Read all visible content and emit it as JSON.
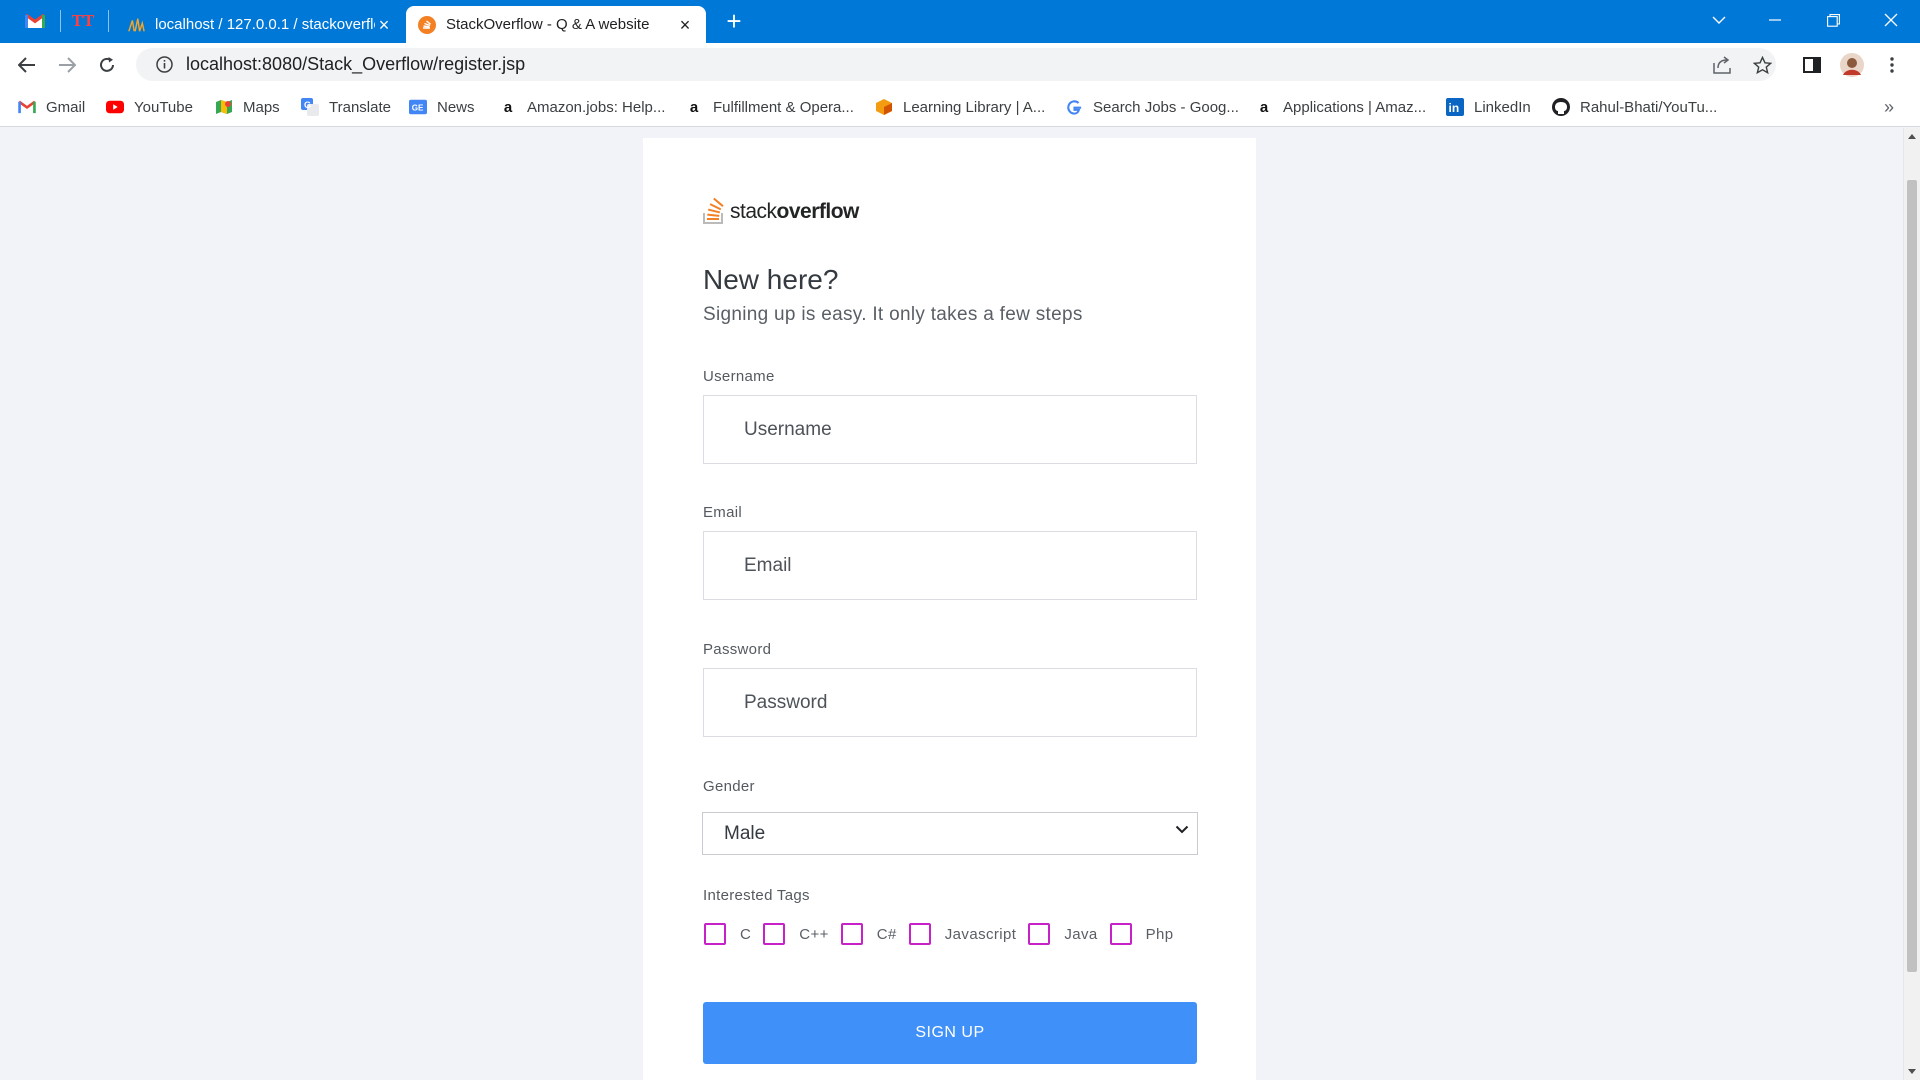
{
  "browser": {
    "tabs": [
      {
        "title": "localhost / 127.0.0.1 / stackoverflow",
        "active": false
      },
      {
        "title": "StackOverflow - Q & A website",
        "active": true
      }
    ],
    "url": "localhost:8080/Stack_Overflow/register.jsp",
    "bookmarks": [
      {
        "label": "Gmail",
        "icon": "gmail-icon"
      },
      {
        "label": "YouTube",
        "icon": "youtube-icon"
      },
      {
        "label": "Maps",
        "icon": "maps-icon"
      },
      {
        "label": "Translate",
        "icon": "translate-icon"
      },
      {
        "label": "News",
        "icon": "news-icon"
      },
      {
        "label": "Amazon.jobs: Help...",
        "icon": "amazon-icon"
      },
      {
        "label": "Fulfillment & Opera...",
        "icon": "amazon-icon"
      },
      {
        "label": "Learning Library | A...",
        "icon": "cube-icon"
      },
      {
        "label": "Search Jobs - Goog...",
        "icon": "google-icon"
      },
      {
        "label": "Applications | Amaz...",
        "icon": "amazon-icon"
      },
      {
        "label": "LinkedIn",
        "icon": "linkedin-icon"
      },
      {
        "label": "Rahul-Bhati/YouTu...",
        "icon": "github-icon"
      }
    ],
    "overflow_label": "»"
  },
  "page": {
    "logo": {
      "light": "stack",
      "bold": "overflow"
    },
    "heading": "New here?",
    "subheading": "Signing up is easy. It only takes a few steps",
    "username": {
      "label": "Username",
      "placeholder": "Username"
    },
    "email": {
      "label": "Email",
      "placeholder": "Email"
    },
    "password": {
      "label": "Password",
      "placeholder": "Password"
    },
    "gender": {
      "label": "Gender",
      "selected": "Male"
    },
    "tags": {
      "label": "Interested Tags",
      "options": [
        "C",
        "C++",
        "C#",
        "Javascript",
        "Java",
        "Php"
      ]
    },
    "signup_label": "SIGN UP"
  },
  "colors": {
    "chrome_blue": "#0078d7",
    "button_blue": "#3f90f8",
    "checkbox_magenta": "#c722c7",
    "page_bg": "#f2f3f8"
  }
}
